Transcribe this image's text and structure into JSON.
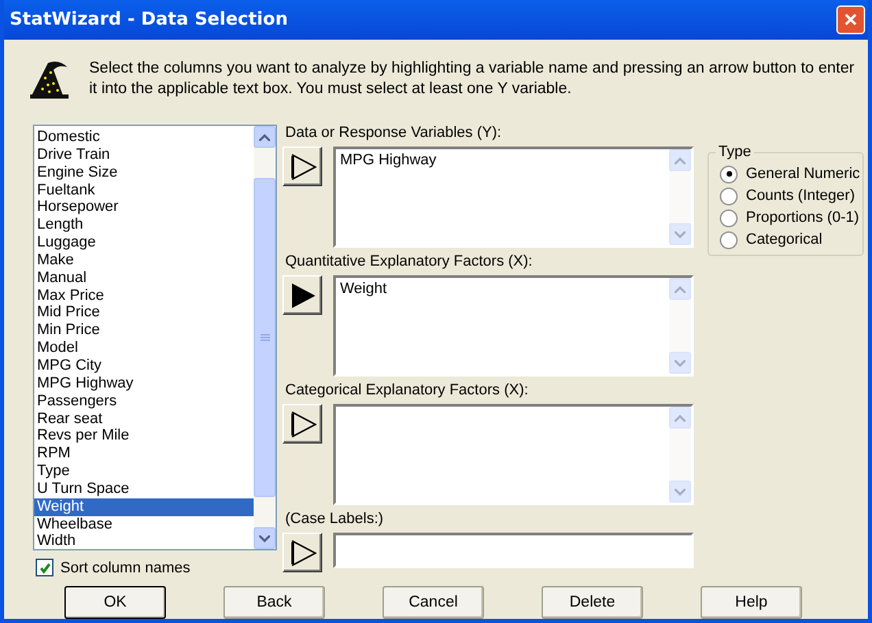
{
  "window": {
    "title": "StatWizard - Data Selection",
    "close_label": "✕"
  },
  "instructions": "Select the columns you want to analyze by highlighting a variable name and pressing an arrow button to enter it into the applicable text box. You must select at least one Y variable.",
  "columns": [
    {
      "name": "Domestic",
      "selected": false
    },
    {
      "name": "Drive Train",
      "selected": false
    },
    {
      "name": "Engine Size",
      "selected": false
    },
    {
      "name": "Fueltank",
      "selected": false
    },
    {
      "name": "Horsepower",
      "selected": false
    },
    {
      "name": "Length",
      "selected": false
    },
    {
      "name": "Luggage",
      "selected": false
    },
    {
      "name": "Make",
      "selected": false
    },
    {
      "name": "Manual",
      "selected": false
    },
    {
      "name": "Max Price",
      "selected": false
    },
    {
      "name": "Mid Price",
      "selected": false
    },
    {
      "name": "Min Price",
      "selected": false
    },
    {
      "name": "Model",
      "selected": false
    },
    {
      "name": "MPG City",
      "selected": false
    },
    {
      "name": "MPG Highway",
      "selected": false
    },
    {
      "name": "Passengers",
      "selected": false
    },
    {
      "name": "Rear seat",
      "selected": false
    },
    {
      "name": "Revs per Mile",
      "selected": false
    },
    {
      "name": "RPM",
      "selected": false
    },
    {
      "name": "Type",
      "selected": false
    },
    {
      "name": "U Turn Space",
      "selected": false
    },
    {
      "name": "Weight",
      "selected": true
    },
    {
      "name": "Wheelbase",
      "selected": false
    },
    {
      "name": "Width",
      "selected": false
    }
  ],
  "sort_columns": {
    "label": "Sort column names",
    "checked": true
  },
  "targets": [
    {
      "label": "Data or Response Variables (Y):",
      "arrow_enabled": false,
      "kind": "multi",
      "items": [
        "MPG Highway"
      ]
    },
    {
      "label": "Quantitative Explanatory Factors (X):",
      "arrow_enabled": true,
      "kind": "multi",
      "items": [
        "Weight"
      ]
    },
    {
      "label": "Categorical Explanatory Factors (X):",
      "arrow_enabled": false,
      "kind": "multi"
    },
    {
      "label": "(Case Labels:)",
      "arrow_enabled": false,
      "kind": "single"
    }
  ],
  "type_group": {
    "title": "Type",
    "options": [
      {
        "label": "General Numeric",
        "selected": true
      },
      {
        "label": "Counts (Integer)",
        "selected": false
      },
      {
        "label": "Proportions (0-1)",
        "selected": false
      },
      {
        "label": "Categorical",
        "selected": false
      }
    ]
  },
  "buttons": [
    {
      "label": "OK",
      "default": true
    },
    {
      "label": "Back",
      "default": false
    },
    {
      "label": "Cancel",
      "default": false
    },
    {
      "label": "Delete",
      "default": false
    },
    {
      "label": "Help",
      "default": false
    }
  ]
}
